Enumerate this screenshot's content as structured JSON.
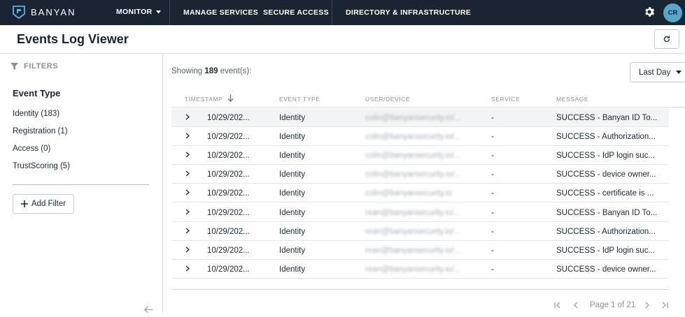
{
  "app": {
    "brand": "BANYAN"
  },
  "nav": {
    "monitor": "MONITOR",
    "manage_services": "MANAGE SERVICES",
    "secure_access": "SECURE ACCESS",
    "directory": "DIRECTORY & INFRASTRUCTURE",
    "avatar_initials": "CR"
  },
  "page": {
    "title": "Events Log Viewer"
  },
  "filters": {
    "header": "FILTERS",
    "section_title": "Event Type",
    "options": [
      {
        "label": "Identity (183)"
      },
      {
        "label": "Registration (1)"
      },
      {
        "label": "Access (0)"
      },
      {
        "label": "TrustScoring (5)"
      }
    ],
    "add_filter": "Add Filter"
  },
  "summary": {
    "prefix": "Showing",
    "count": "189",
    "suffix": "event(s):"
  },
  "time_range": {
    "selected": "Last Day"
  },
  "table": {
    "columns": {
      "timestamp": "TIMESTAMP",
      "event_type": "EVENT TYPE",
      "user_device": "USER/DEVICE",
      "service": "SERVICE",
      "message": "MESSAGE"
    },
    "rows": [
      {
        "timestamp": "10/29/202...",
        "event_type": "Identity",
        "user": "colin@banyansecurity.io/...",
        "service": "-",
        "message": "SUCCESS - Banyan ID To..."
      },
      {
        "timestamp": "10/29/202...",
        "event_type": "Identity",
        "user": "colin@banyansecurity.io/...",
        "service": "-",
        "message": "SUCCESS - Authorization..."
      },
      {
        "timestamp": "10/29/202...",
        "event_type": "Identity",
        "user": "colin@banyansecurity.io/...",
        "service": "-",
        "message": "SUCCESS - IdP login suc..."
      },
      {
        "timestamp": "10/29/202...",
        "event_type": "Identity",
        "user": "colin@banyansecurity.io/...",
        "service": "-",
        "message": "SUCCESS - device owner..."
      },
      {
        "timestamp": "10/29/202...",
        "event_type": "Identity",
        "user": "colin@banyansecurity.io",
        "service": "-",
        "message": "SUCCESS - certificate is ..."
      },
      {
        "timestamp": "10/29/202...",
        "event_type": "Identity",
        "user": "rean@banyansecurity.io/...",
        "service": "-",
        "message": "SUCCESS - Banyan ID To..."
      },
      {
        "timestamp": "10/29/202...",
        "event_type": "Identity",
        "user": "rean@banyansecurity.io/...",
        "service": "-",
        "message": "SUCCESS - Authorization..."
      },
      {
        "timestamp": "10/29/202...",
        "event_type": "Identity",
        "user": "rean@banyansecurity.io/...",
        "service": "-",
        "message": "SUCCESS - IdP login suc..."
      },
      {
        "timestamp": "10/29/202...",
        "event_type": "Identity",
        "user": "rean@banyansecurity.io/...",
        "service": "-",
        "message": "SUCCESS - device owner..."
      }
    ]
  },
  "pagination": {
    "label": "Page 1 of 21"
  },
  "colors": {
    "nav_bg": "#1b2432",
    "avatar": "#55a8c9"
  },
  "icons": [
    "banyan-logo-icon",
    "caret-down-icon",
    "gear-icon",
    "refresh-icon",
    "filter-icon",
    "plus-icon",
    "chevron-right-icon",
    "arrow-down-icon",
    "arrow-left-icon",
    "first-page-icon",
    "prev-page-icon",
    "next-page-icon",
    "last-page-icon"
  ]
}
